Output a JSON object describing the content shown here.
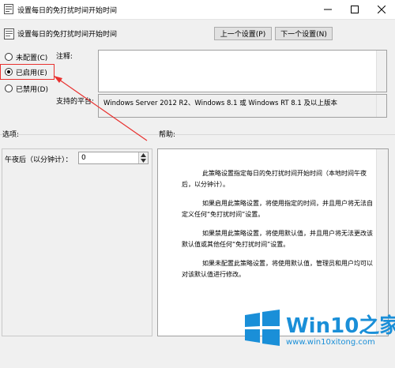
{
  "window": {
    "title": "设置每日的免打扰时间开始时间"
  },
  "header": {
    "title": "设置每日的免打扰时间开始时间",
    "prev_button": "上一个设置(P)",
    "next_button": "下一个设置(N)"
  },
  "state": {
    "options": [
      {
        "label": "未配置(C)",
        "checked": false
      },
      {
        "label": "已启用(E)",
        "checked": true
      },
      {
        "label": "已禁用(D)",
        "checked": false
      }
    ]
  },
  "comment": {
    "label": "注释:",
    "value": ""
  },
  "supported": {
    "label": "支持的平台:",
    "value": "Windows Server 2012 R2、Windows 8.1 或 Windows RT 8.1 及以上版本"
  },
  "options_panel": {
    "label": "选项:",
    "field_label": "午夜后（以分钟计）：",
    "field_value": "0"
  },
  "help_panel": {
    "label": "帮助:",
    "paragraphs": [
      "此策略设置指定每日的免打扰时间开始时间（本地时间午夜后，以分钟计）。",
      "如果启用此策略设置，将使用指定的时间，并且用户将无法自定义任何“免打扰时间”设置。",
      "如果禁用此策略设置，将使用默认值，并且用户将无法更改该默认值或其他任何“免打扰时间”设置。",
      "如果未配置此策略设置，将使用默认值，管理员和用户均可以对该默认值进行修改。"
    ]
  },
  "watermark": {
    "brand": "Win10之家",
    "url": "www.win10xitong.com"
  },
  "colors": {
    "annotation_red": "#e8312f",
    "win_blue": "#1a8fd8"
  }
}
